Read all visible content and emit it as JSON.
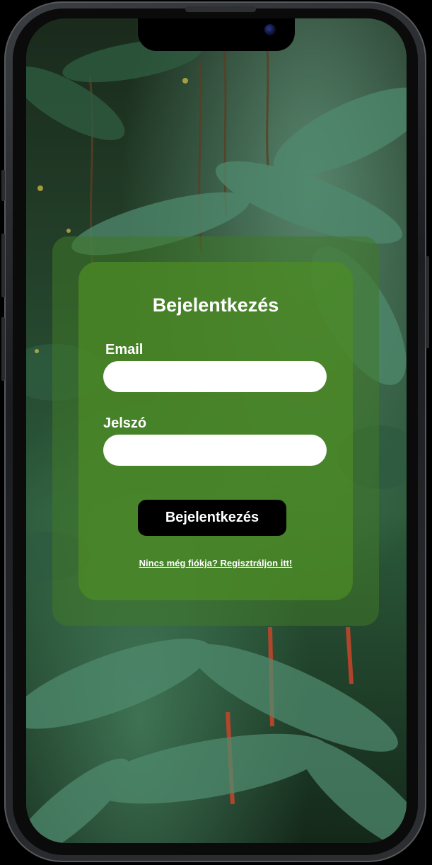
{
  "login": {
    "title": "Bejelentkezés",
    "email_label": "Email",
    "email_value": "",
    "password_label": "Jelszó",
    "password_value": "",
    "submit_label": "Bejelentkezés",
    "register_link": "Nincs még fiókja? Regisztráljon itt!"
  },
  "colors": {
    "card_outer": "#40782a",
    "card_inner": "#4e8c26",
    "button": "#000000",
    "text": "#ffffff"
  }
}
